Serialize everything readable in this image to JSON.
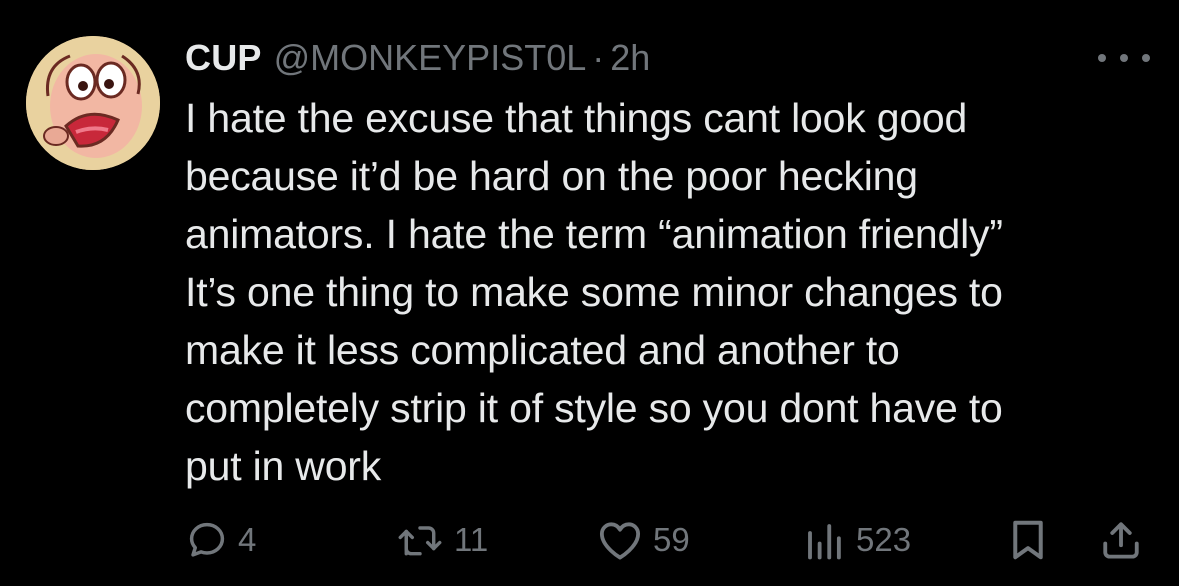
{
  "tweet": {
    "display_name": "CUP",
    "handle": "@MONKEYPIST0L",
    "separator": "·",
    "time": "2h",
    "text": "I hate the excuse that things cant look good\nbecause it’d be hard on the poor hecking\nanimators. I hate the term “animation friendly”\nIt’s one thing to make some minor changes to\nmake it less complicated and another to\ncompletely strip it of style so you dont have to\nput in work"
  },
  "actions": {
    "replies": "4",
    "retweets": "11",
    "likes": "59",
    "views": "523"
  },
  "icons": {
    "more": "more-horizontal-icon",
    "reply": "reply-bubble-icon",
    "retweet": "retweet-icon",
    "like": "heart-icon",
    "views": "bar-chart-icon",
    "bookmark": "bookmark-icon",
    "share": "share-upload-icon"
  },
  "colors": {
    "background": "#000000",
    "primary_text": "#e7e9ea",
    "secondary_text": "#71767b"
  }
}
